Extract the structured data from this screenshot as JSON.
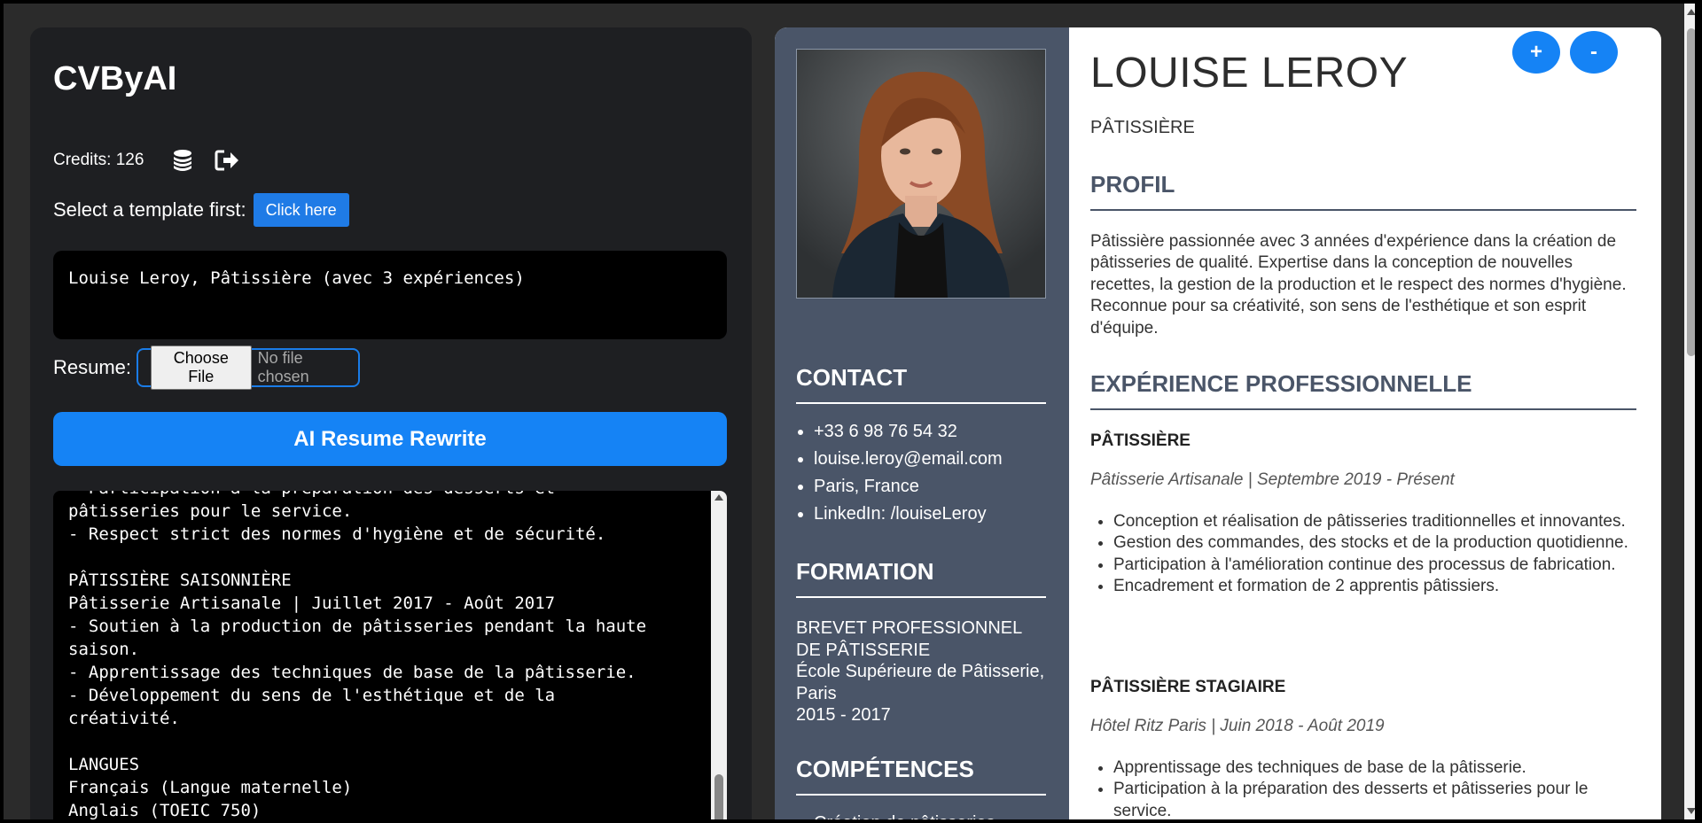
{
  "app": {
    "title": "CVByAI",
    "credits_label": "Credits: 126",
    "coins_icon": "coins-icon",
    "logout_icon": "logout-icon",
    "template_prompt": "Select a template first:",
    "template_button": "Click here",
    "prompt_text": "Louise Leroy, Pâtissière (avec 3 expériences)",
    "resume_label": "Resume:",
    "choose_file": "Choose File",
    "no_file": "No file chosen",
    "rewrite_button": "AI Resume Rewrite",
    "output_text": "- Participation à la préparation des desserts et\npâtisseries pour le service.\n- Respect strict des normes d'hygiène et de sécurité.\n\nPÂTISSIÈRE SAISONNIÈRE\nPâtisserie Artisanale | Juillet 2017 - Août 2017\n- Soutien à la production de pâtisseries pendant la haute\nsaison.\n- Apprentissage des techniques de base de la pâtisserie.\n- Développement du sens de l'esthétique et de la\ncréativité.\n\nLANGUES\nFrançais (Langue maternelle)\nAnglais (TOEIC 750)"
  },
  "resume": {
    "zoom_in": "+",
    "zoom_out": "-",
    "name": "LOUISE LEROY",
    "job_title": "PÂTISSIÈRE",
    "contact_heading": "CONTACT",
    "contact": [
      "+33 6 98 76 54 32",
      "louise.leroy@email.com",
      "Paris, France",
      "LinkedIn: /louiseLeroy"
    ],
    "formation_heading": "FORMATION",
    "formation": {
      "degree": "BREVET PROFESSIONNEL DE PÂTISSERIE",
      "school": "École Supérieure de Pâtisserie, Paris",
      "years": "2015 - 2017"
    },
    "skills_heading": "COMPÉTENCES",
    "skills": [
      "Création de pâtisseries"
    ],
    "profile_heading": "PROFIL",
    "profile_text": "Pâtissière passionnée avec 3 années d'expérience dans la création de pâtisseries de qualité. Expertise dans la conception de nouvelles recettes, la gestion de la production et le respect des normes d'hygiène. Reconnue pour sa créativité, son sens de l'esthétique et son esprit d'équipe.",
    "experience_heading": "EXPÉRIENCE PROFESSIONNELLE",
    "experience": [
      {
        "title": "PÂTISSIÈRE",
        "company": "Pâtisserie Artisanale | Septembre 2019 - Présent",
        "items": [
          "Conception et réalisation de pâtisseries traditionnelles et innovantes.",
          "Gestion des commandes, des stocks et de la production quotidienne.",
          "Participation à l'amélioration continue des processus de fabrication.",
          "Encadrement et formation de 2 apprentis pâtissiers."
        ]
      },
      {
        "title": "PÂTISSIÈRE STAGIAIRE",
        "company": "Hôtel Ritz Paris | Juin 2018 - Août 2019",
        "items": [
          "Apprentissage des techniques de base de la pâtisserie.",
          "Participation à la préparation des desserts et pâtisseries pour le service."
        ]
      }
    ]
  }
}
